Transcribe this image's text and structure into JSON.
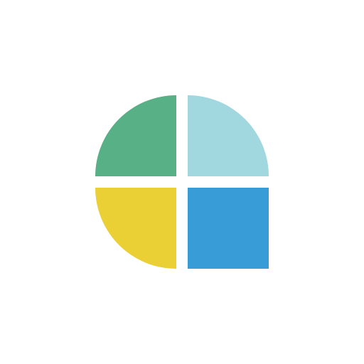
{
  "logo": {
    "icon": "four-quadrant-logo-icon",
    "colors": {
      "top_left": "#57B086",
      "top_right": "#A1D7DF",
      "bottom_left": "#EAD034",
      "bottom_right": "#389CD6",
      "background": "#FFFFFF"
    }
  }
}
